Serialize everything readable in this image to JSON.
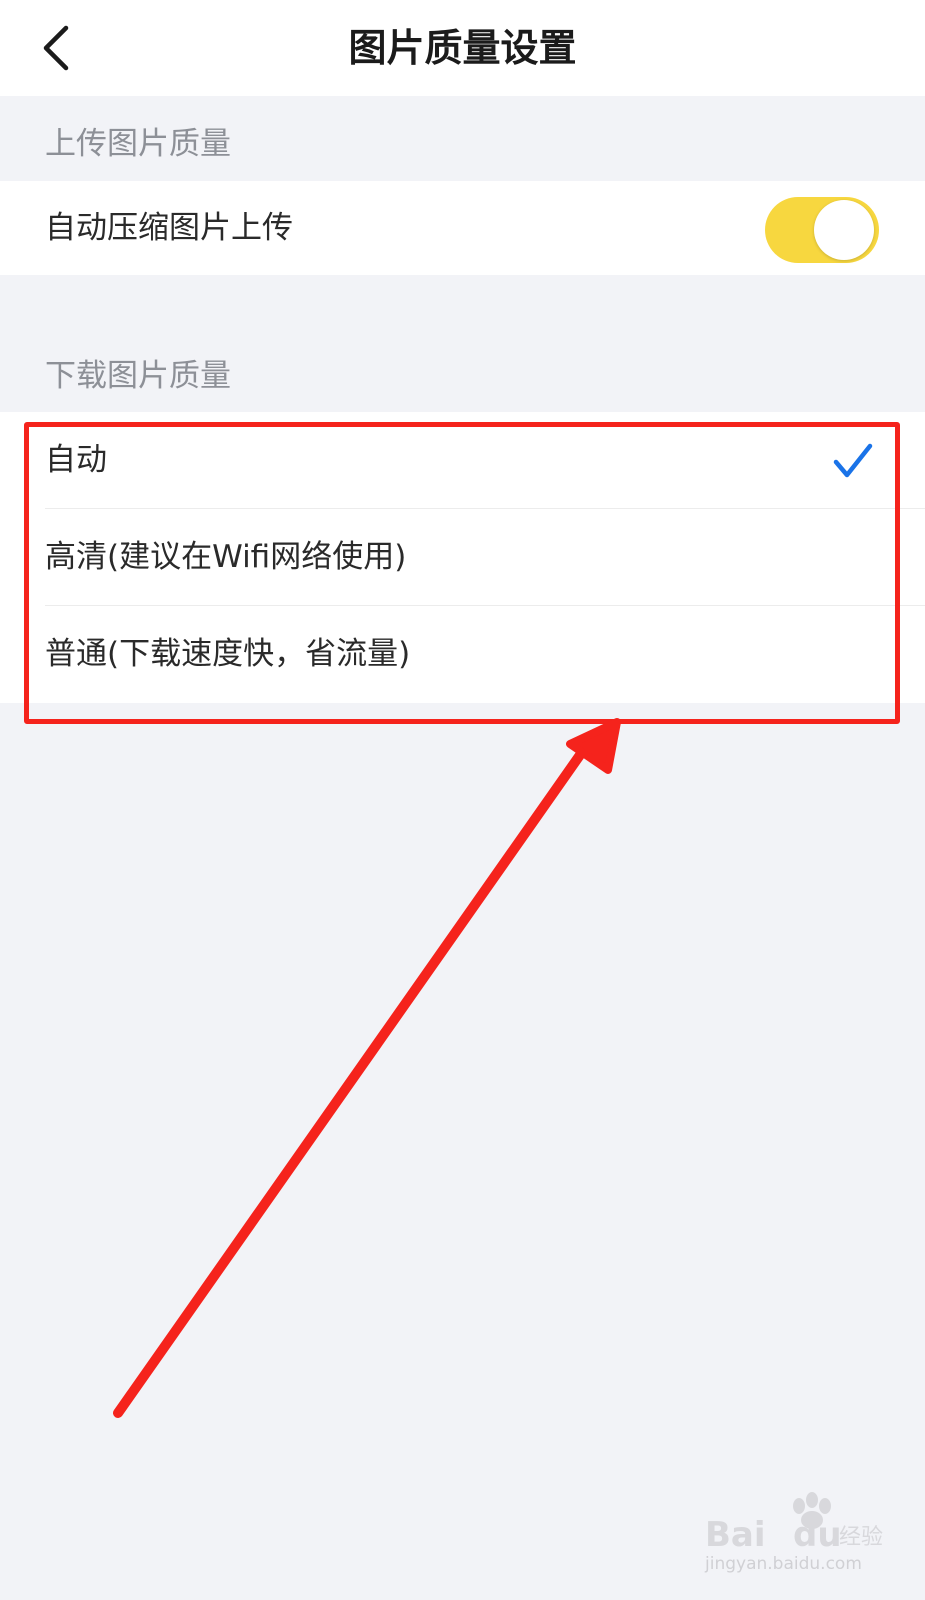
{
  "header": {
    "title": "图片质量设置",
    "back_icon": "chevron-left-icon"
  },
  "upload_section": {
    "header": "上传图片质量",
    "auto_compress": {
      "label": "自动压缩图片上传",
      "enabled": true
    }
  },
  "download_section": {
    "header": "下载图片质量",
    "options": [
      {
        "label": "自动",
        "selected": true
      },
      {
        "label": "高清(建议在Wifi网络使用)",
        "selected": false
      },
      {
        "label": "普通(下载速度快，省流量)",
        "selected": false
      }
    ]
  },
  "colors": {
    "toggle_on": "#f7d73f",
    "check": "#1a73e8",
    "annotation": "#f5231c",
    "background": "#f2f3f7"
  },
  "watermark": {
    "brand": "Baidu经验",
    "url": "jingyan.baidu.com"
  }
}
